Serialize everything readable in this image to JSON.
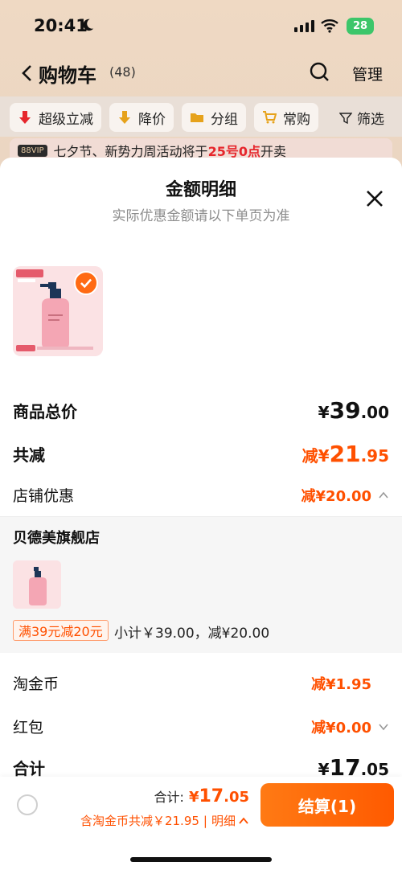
{
  "status_bar": {
    "time": "20:41",
    "battery": "28"
  },
  "nav": {
    "title": "购物车",
    "count": "(48)",
    "manage": "管理"
  },
  "filters": {
    "chips": [
      {
        "label": "超级立减"
      },
      {
        "label": "降价"
      },
      {
        "label": "分组"
      },
      {
        "label": "常购"
      }
    ],
    "filter_label": "筛选"
  },
  "promo": {
    "badge": "88VIP",
    "text_before": "七夕节、新势力周活动将于",
    "highlight": "25号0点",
    "text_after": "开卖"
  },
  "sheet": {
    "title": "金额明细",
    "subtitle": "实际优惠金额请以下单页为准",
    "rows": {
      "goods_total": {
        "label": "商品总价",
        "cur": "¥",
        "int": "39",
        "dec": ".00"
      },
      "total_reduce": {
        "label": "共减",
        "prefix": "减¥",
        "int": "21",
        "dec": ".95"
      },
      "shop_discount": {
        "label": "店铺优惠",
        "value": "减¥20.00"
      },
      "taojinbi": {
        "label": "淘金币",
        "value": "减¥1.95"
      },
      "hongbao": {
        "label": "红包",
        "value": "减¥0.00"
      },
      "sum": {
        "label": "合计",
        "cur": "¥",
        "int": "17",
        "dec": ".05"
      }
    },
    "shop": {
      "name": "贝德美旗舰店",
      "coupon": "满39元减20元",
      "subtotal": "小计￥39.00，减¥20.00"
    }
  },
  "bottom": {
    "total_label": "合计:",
    "total_cur": "¥",
    "total_int": "17",
    "total_dec": ".05",
    "discount_text": "含淘金币共减￥21.95",
    "detail_label": "明细",
    "checkout": "结算(1)"
  },
  "colors": {
    "accent": "#ff5000",
    "checkout_start": "#ff7a14",
    "checkout_end": "#ff5a00"
  },
  "icons": [
    "moon-icon",
    "signal-icon",
    "wifi-icon",
    "back-icon",
    "search-icon",
    "close-icon",
    "check-icon",
    "chevron-up-icon",
    "chevron-down-icon",
    "filter-icon"
  ]
}
